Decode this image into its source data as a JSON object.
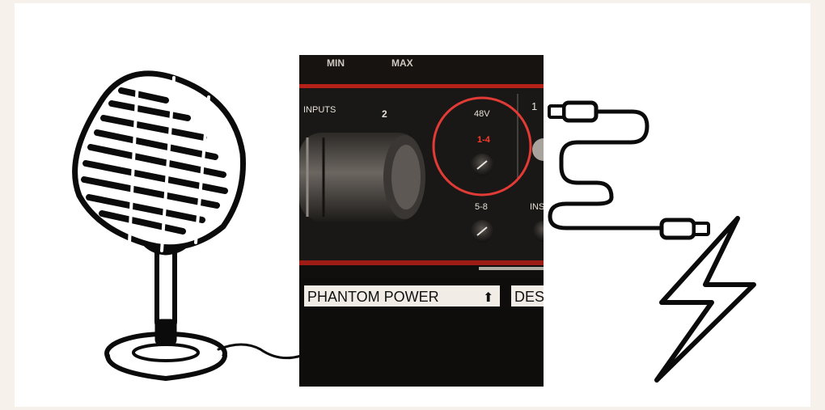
{
  "illustration": {
    "left_icon": "microphone-icon",
    "right_icons": [
      "usb-cable-icon",
      "lightning-bolt-icon"
    ]
  },
  "photo": {
    "knob_labels": [
      "MIN",
      "MAX"
    ],
    "inputs_label": "INPUTS",
    "channel_label": "2",
    "phantom_label": "48V",
    "switch_range_1": "1-4",
    "switch_range_2": "5-8",
    "next_channel_label": "1",
    "partial_label": "INS",
    "tape_label_1": "PHANTOM POWER",
    "tape_arrow": "⬆",
    "tape_label_2": "DES",
    "highlight_color": "#e23b36",
    "led_color": "#ff3a2a"
  }
}
